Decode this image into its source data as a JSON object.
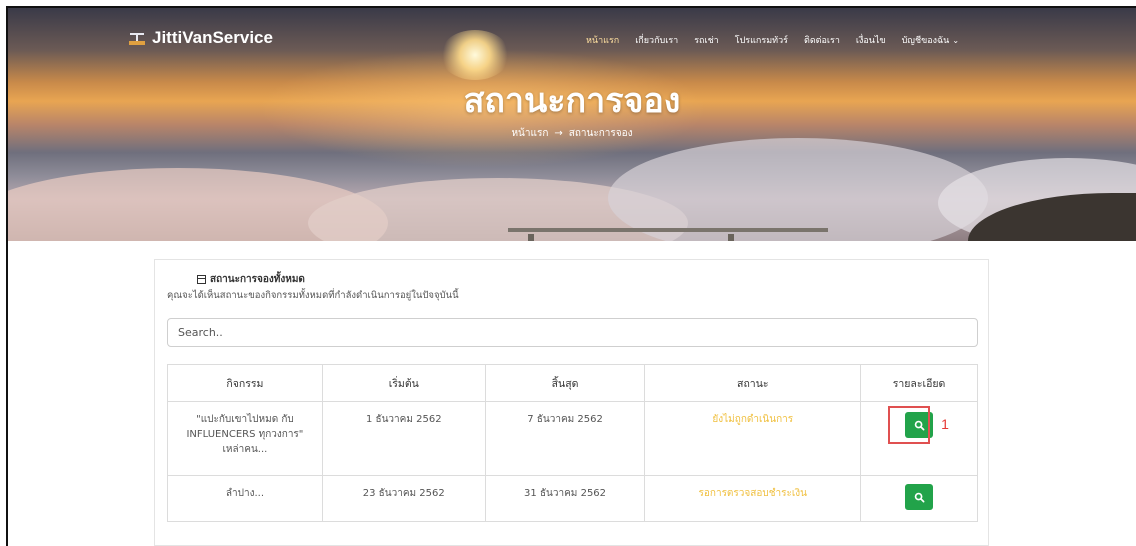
{
  "brand": {
    "name": "JittiVanService",
    "logo_small_text": "Jitti"
  },
  "nav": {
    "items": [
      "หน้าแรก",
      "เกี่ยวกับเรา",
      "รถเช่า",
      "โปรแกรมทัวร์",
      "ติดต่อเรา",
      "เงื่อนไข",
      "บัญชีของฉัน"
    ],
    "account_caret": "⌄"
  },
  "hero": {
    "title": "สถานะการจอง",
    "breadcrumb_home": "หน้าแรก",
    "breadcrumb_arrow": "→",
    "breadcrumb_current": "สถานะการจอง"
  },
  "card": {
    "title": "สถานะการจองทั้งหมด",
    "subtitle": "คุณจะได้เห็นสถานะของกิจกรรมทั้งหมดที่กำลังดำเนินการอยู่ในปัจจุบันนี้",
    "search_placeholder": "Search.."
  },
  "table": {
    "headers": [
      "กิจกรรม",
      "เริ่มต้น",
      "สิ้นสุด",
      "สถานะ",
      "รายละเอียด"
    ],
    "rows": [
      {
        "activity": "\"แปะกับเขาไปหมด กับ INFLUENCERS ทุกวงการ\" เหล่าคน...",
        "start": "1 ธันวาคม 2562",
        "end": "7 ธันวาคม 2562",
        "status": "ยังไม่ถูกดำเนินการ"
      },
      {
        "activity": "ลำปาง...",
        "start": "23 ธันวาคม 2562",
        "end": "31 ธันวาคม 2562",
        "status": "รอการตรวจสอบชำระเงิน"
      }
    ]
  },
  "annotation": {
    "marker": "1",
    "color": "#e53935"
  },
  "colors": {
    "status": "#f0c040",
    "button": "#22a34a"
  }
}
